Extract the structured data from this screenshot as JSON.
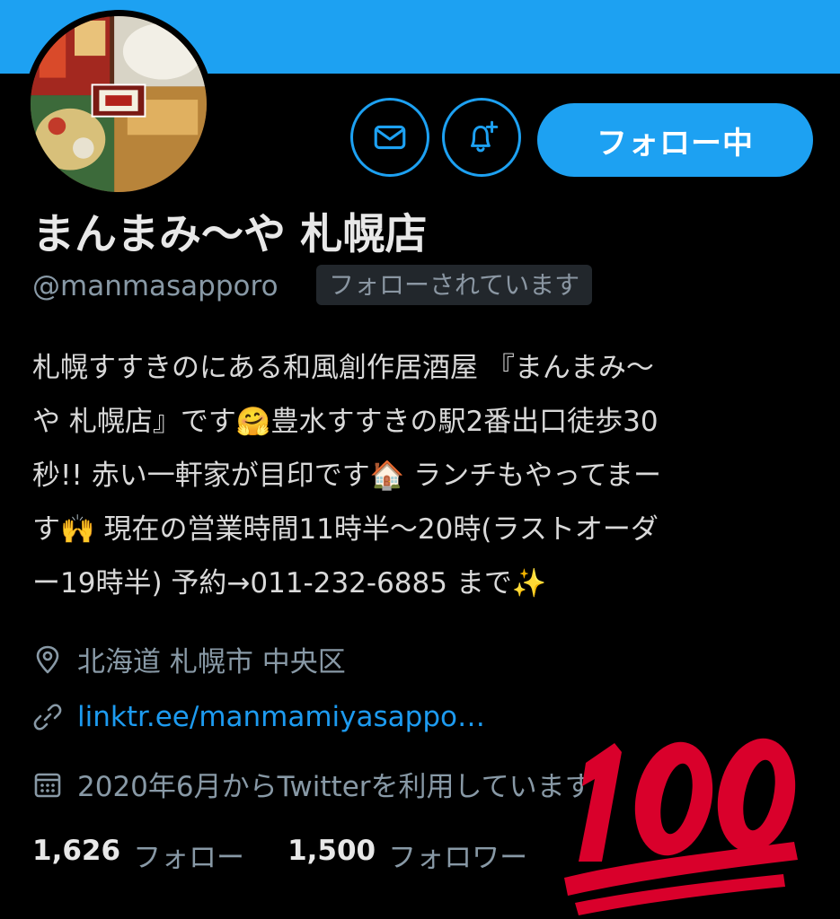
{
  "profile": {
    "display_name": "まんまみ〜や 札幌店",
    "handle": "@manmasapporo",
    "follows_you": "フォローされています",
    "follow_button": "フォロー中",
    "bio_lines": [
      "札幌すすきのにある和風創作居酒屋 『まんまみ〜",
      "や 札幌店』です🤗豊水すすきの駅2番出口徒歩30",
      "秒!! 赤い一軒家が目印です🏠 ランチもやってまー",
      "す🙌 現在の営業時間11時半〜20時(ラストオーダ",
      "ー19時半) 予約→011-232-6885 まで✨"
    ],
    "location": "北海道 札幌市 中央区",
    "link": "linktr.ee/manmamiyasappo…",
    "joined": "2020年6月からTwitterを利用しています",
    "following_count": "1,626",
    "following_label": "フォロー",
    "followers_count": "1,500",
    "followers_label": "フォロワー"
  },
  "icons": {
    "message": "mail-icon",
    "notifications": "bell-plus-icon",
    "location": "location-pin-icon",
    "link": "link-icon",
    "joined": "calendar-icon",
    "sticker": "hundred-points-emoji"
  },
  "colors": {
    "accent": "#1da1f2",
    "background": "#000000",
    "secondary_text": "#8899a6",
    "sticker": "#d9002b"
  }
}
